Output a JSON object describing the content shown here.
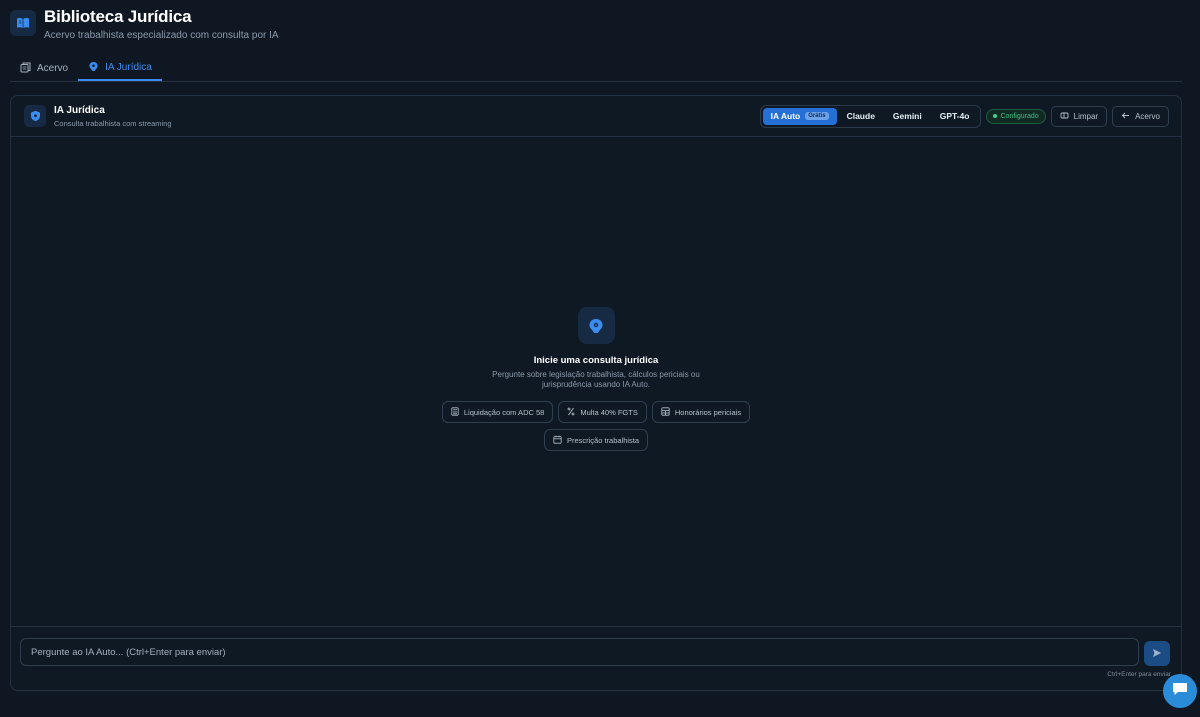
{
  "app": {
    "title": "Biblioteca Jurídica",
    "subtitle": "Acervo trabalhista especializado com consulta por IA"
  },
  "tabs": [
    {
      "label": "Acervo",
      "icon": "library-icon",
      "active": false
    },
    {
      "label": "IA Jurídica",
      "icon": "brain-icon",
      "active": true
    }
  ],
  "panel": {
    "title": "IA Jurídica",
    "subtitle": "Consulta trabalhista com streaming",
    "models": [
      {
        "label": "IA Auto",
        "badge": "Grátis",
        "active": true
      },
      {
        "label": "Claude",
        "active": false
      },
      {
        "label": "Gemini",
        "active": false
      },
      {
        "label": "GPT-4o",
        "active": false
      }
    ],
    "status": "Configurado",
    "clear_label": "Limpar",
    "back_label": "Acervo"
  },
  "empty_state": {
    "title": "Inicie uma consulta jurídica",
    "description": "Pergunte sobre legislação trabalhista, cálculos periciais ou jurisprudência usando IA Auto.",
    "suggestions": [
      {
        "label": "Liquidação com ADC 58",
        "icon": "calculator-icon"
      },
      {
        "label": "Multa 40% FGTS",
        "icon": "percent-icon"
      },
      {
        "label": "Honorários periciais",
        "icon": "table-icon"
      },
      {
        "label": "Prescrição trabalhista",
        "icon": "calendar-icon"
      }
    ]
  },
  "composer": {
    "placeholder": "Pergunte ao IA Auto... (Ctrl+Enter para enviar)",
    "hint": "Ctrl+Enter para enviar"
  },
  "colors": {
    "background": "#0f1822",
    "accent": "#2470d6",
    "status_green": "#3fbf84"
  }
}
